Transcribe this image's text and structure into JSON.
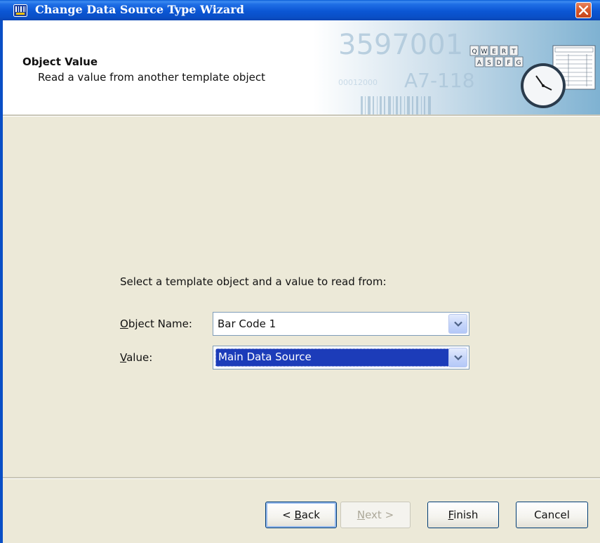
{
  "window": {
    "title": "Change Data Source Type Wizard",
    "close_icon": "close-icon",
    "app_icon": "bartender-app-icon"
  },
  "header": {
    "title": "Object Value",
    "subtitle": "Read a value from another template object",
    "art": {
      "numbers_1": "3597001",
      "numbers_2": "A7-118",
      "numbers_3": "00012000",
      "keys_row_1": [
        "Q",
        "W",
        "E",
        "R",
        "T"
      ],
      "keys_row_2": [
        "A",
        "S",
        "D",
        "F",
        "G"
      ],
      "clock_icon": "clock-icon"
    }
  },
  "form": {
    "instruction": "Select a template object and a value to read from:",
    "object_name": {
      "label_mnemonic": "O",
      "label_rest": "bject Name:",
      "value": "Bar Code 1"
    },
    "value": {
      "label_mnemonic": "V",
      "label_rest": "alue:",
      "value": "Main Data Source"
    }
  },
  "buttons": {
    "back": {
      "prefix": "< ",
      "mnemonic": "B",
      "rest": "ack"
    },
    "next": {
      "mnemonic": "N",
      "rest": "ext >"
    },
    "finish": {
      "mnemonic": "F",
      "rest": "inish"
    },
    "cancel": {
      "label": "Cancel"
    }
  },
  "colors": {
    "titlebar": "#0a5fd8",
    "dialog_bg": "#ece9d8",
    "selection": "#1c3cb9"
  }
}
